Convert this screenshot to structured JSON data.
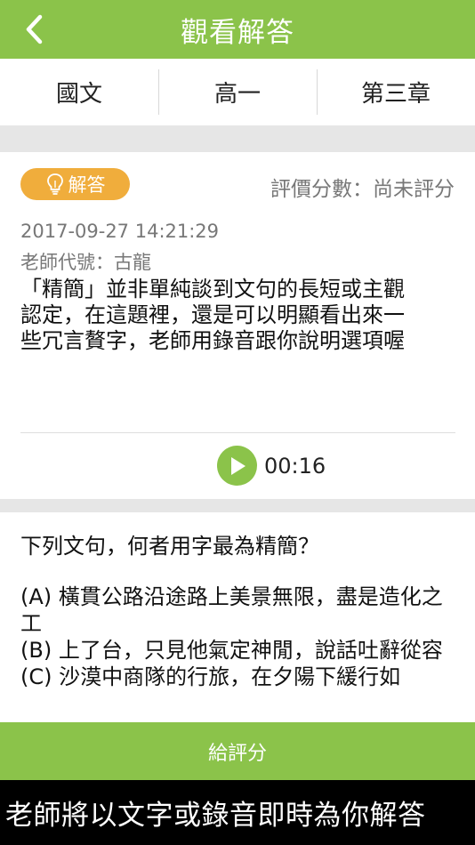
{
  "header": {
    "title": "觀看解答",
    "back_icon": "chevron-left-icon"
  },
  "tabs": [
    {
      "label": "國文"
    },
    {
      "label": "高一"
    },
    {
      "label": "第三章"
    }
  ],
  "answer": {
    "badge_label": "解答",
    "badge_icon": "lightbulb-icon",
    "rating_text": "評價分數：尚未評分",
    "timestamp": "2017-09-27 14:21:29",
    "teacher": "老師代號：古龍",
    "lines": [
      "「精簡」並非單純談到文句的長短或主觀",
      "認定，在這題裡，還是可以明顯看出來一",
      "些冗言贅字，老師用錄音跟你說明選項喔"
    ],
    "audio_duration": "00:16"
  },
  "question": {
    "title": "下列文句，何者用字最為精簡？",
    "options": [
      "(A) 橫貫公路沿途路上美景無限，盡是造化之工",
      "(B) 上了台，只見他氣定神閒，說話吐辭從容",
      "(C) 沙漠中商隊的行旅，在夕陽下緩行如"
    ]
  },
  "footer": {
    "rate_button": "給評分",
    "caption": "老師將以文字或錄音即時為你解答"
  },
  "colors": {
    "accent": "#8bc34a",
    "badge": "#f0ad3c",
    "caption_bg": "#000000"
  }
}
